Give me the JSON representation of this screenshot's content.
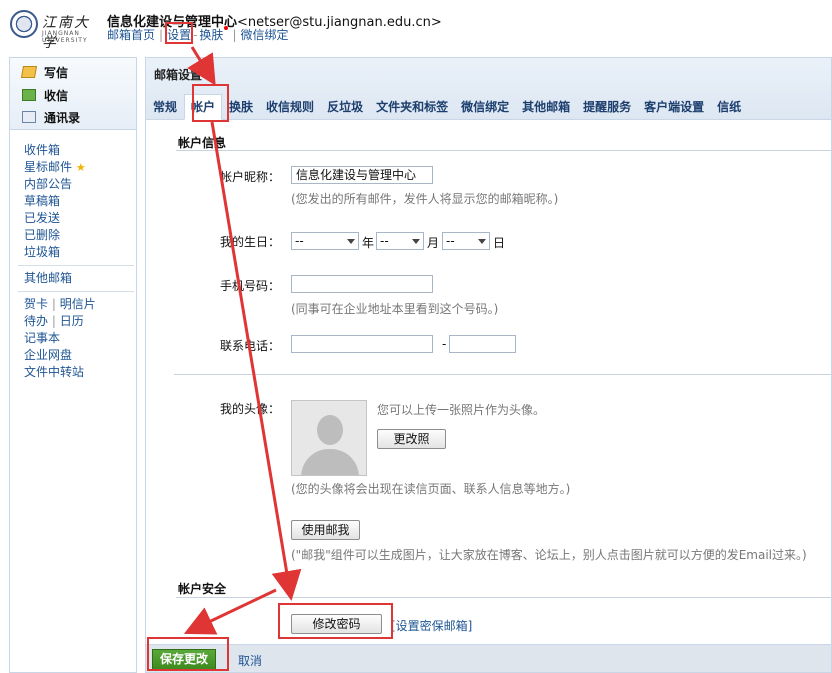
{
  "header": {
    "logo_name": "江南大学",
    "logo_sub": "JIANGNAN UNIVERSITY",
    "account_name": "信息化建设与管理中心",
    "account_email": "<netser@stu.jiangnan.edu.cn>",
    "links": [
      "邮箱首页",
      "设置",
      "换肤",
      "微信绑定"
    ]
  },
  "sidebar": {
    "compose": [
      "写信",
      "收信",
      "通讯录"
    ],
    "folders": [
      "收件箱",
      "星标邮件",
      "内部公告",
      "草稿箱",
      "已发送",
      "已删除",
      "垃圾箱"
    ],
    "other": [
      "其他邮箱"
    ],
    "tools": [
      [
        "贺卡",
        "明信片"
      ],
      [
        "待办",
        "日历"
      ],
      [
        "记事本"
      ],
      [
        "企业网盘"
      ],
      [
        "文件中转站"
      ]
    ]
  },
  "main": {
    "title": "邮箱设置",
    "tabs": [
      "常规",
      "帐户",
      "换肤",
      "收信规则",
      "反垃圾",
      "文件夹和标签",
      "微信绑定",
      "其他邮箱",
      "提醒服务",
      "客户端设置",
      "信纸"
    ],
    "active_tab": "帐户"
  },
  "account_info": {
    "section_title": "帐户信息",
    "nickname_label": "帐户昵称：",
    "nickname_value": "信息化建设与管理中心",
    "nickname_hint": "(您发出的所有邮件，发件人将显示您的邮箱昵称。)",
    "birthday_label": "我的生日：",
    "birthday_year": "--",
    "birthday_month": "--",
    "birthday_day": "--",
    "unit_year": "年",
    "unit_month": "月",
    "unit_day": "日",
    "mobile_label": "手机号码：",
    "mobile_hint": "(同事可在企业地址本里看到这个号码。)",
    "phone_label": "联系电话：",
    "phone_dash": "-",
    "avatar_label": "我的头像：",
    "avatar_tip": "您可以上传一张照片作为头像。",
    "change_photo_btn": "更改照",
    "avatar_hint": "(您的头像将会出现在读信页面、联系人信息等地方。)",
    "use_mailme_btn": "使用邮我",
    "mailme_hint": "(\"邮我\"组件可以生成图片，让大家放在博客、论坛上，别人点击图片就可以方便的发Email过来。)"
  },
  "security": {
    "section_title": "帐户安全",
    "change_pwd_btn": "修改密码",
    "set_secure_link": "[设置密保邮箱]"
  },
  "footer": {
    "save_btn": "保存更改",
    "cancel": "取消"
  },
  "colors": {
    "annotation": "#e03535",
    "link": "#1e5494",
    "save_green": "#4a9a2c"
  }
}
